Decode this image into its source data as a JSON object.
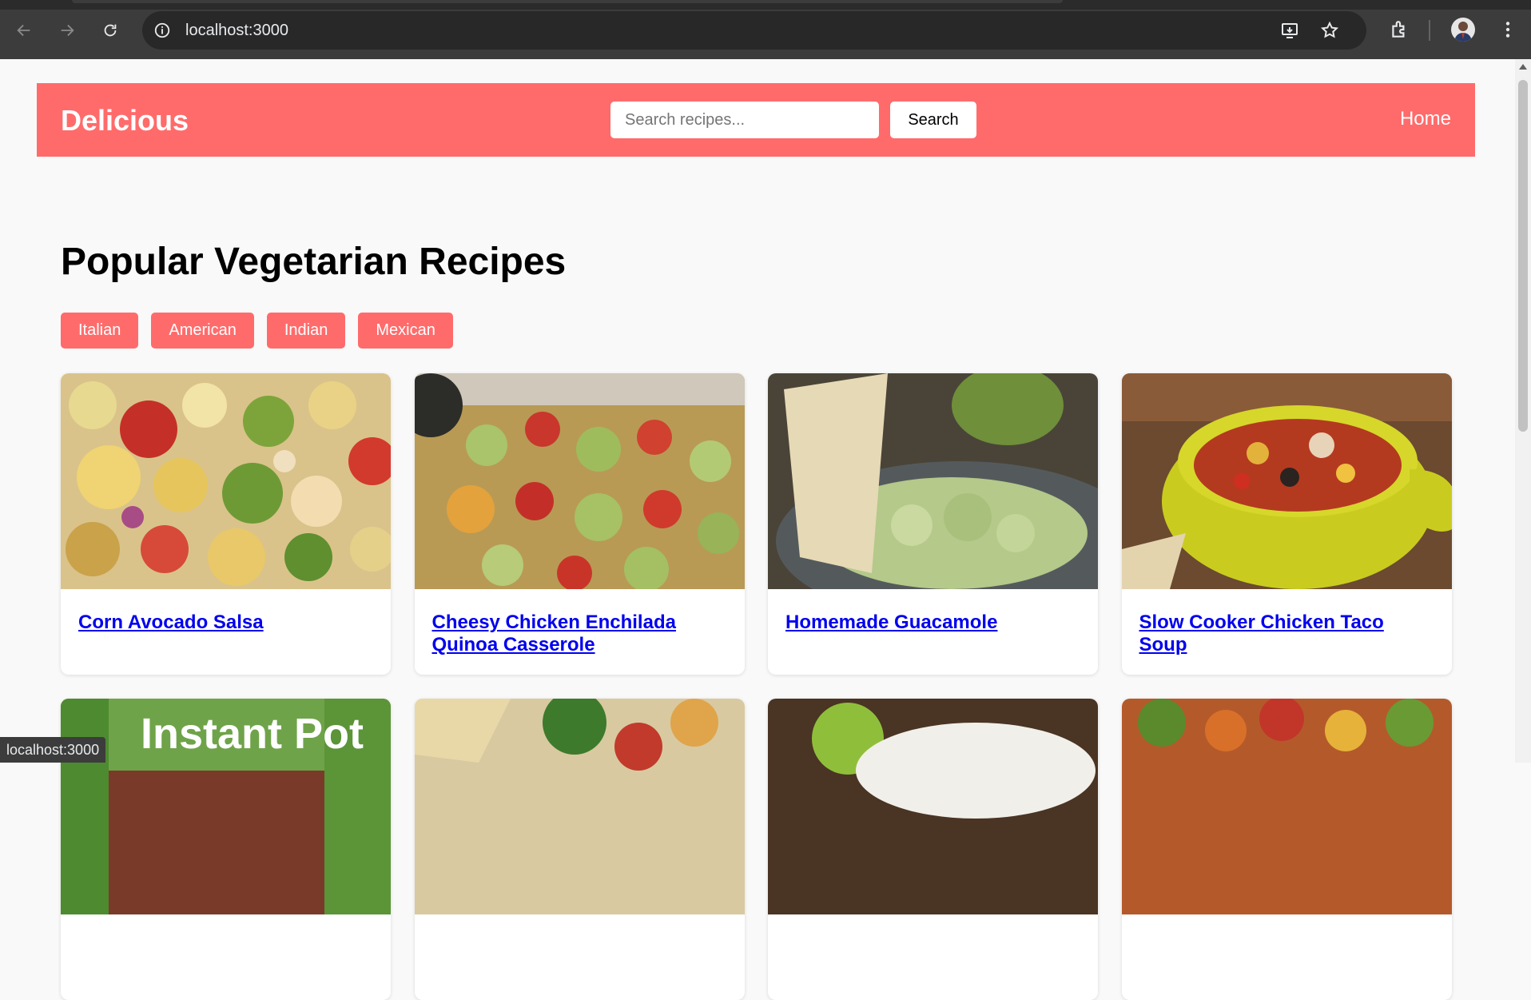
{
  "browser": {
    "url": "localhost:3000",
    "status_text": "localhost:3000"
  },
  "header": {
    "logo": "Delicious",
    "search_placeholder": "Search recipes...",
    "search_button": "Search",
    "nav_home": "Home",
    "accent_color": "#ff6b6b"
  },
  "main": {
    "title": "Popular Vegetarian Recipes",
    "filters": [
      "Italian",
      "American",
      "Indian",
      "Mexican"
    ],
    "recipes": [
      {
        "title": "Corn Avocado Salsa",
        "image": "corn-avocado-salsa-photo"
      },
      {
        "title": "Cheesy Chicken Enchilada Quinoa Casserole",
        "image": "enchilada-casserole-photo"
      },
      {
        "title": "Homemade Guacamole",
        "image": "guacamole-photo"
      },
      {
        "title": "Slow Cooker Chicken Taco Soup",
        "image": "taco-soup-photo"
      },
      {
        "title": "",
        "image": "instant-pot-photo",
        "image_text": "Instant Pot"
      },
      {
        "title": "",
        "image": "nachos-salsa-photo"
      },
      {
        "title": "",
        "image": "lime-bowl-photo"
      },
      {
        "title": "",
        "image": "pepper-salsa-photo"
      }
    ]
  }
}
